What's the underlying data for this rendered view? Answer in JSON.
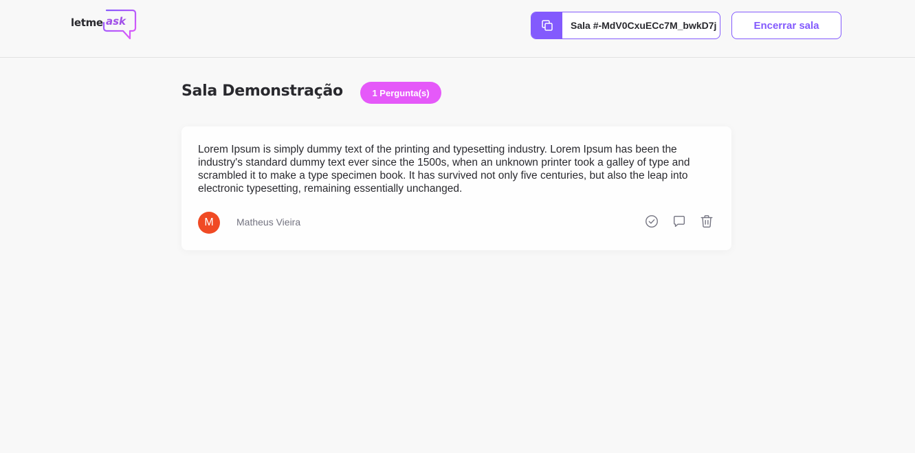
{
  "header": {
    "logo": {
      "part1": "letme",
      "part2": "ask"
    },
    "room_code": {
      "label": "Sala #-MdV0CxuECc7M_bwkD7j",
      "icon": "copy-icon"
    },
    "close_room_label": "Encerrar sala"
  },
  "room": {
    "title": "Sala Demonstração",
    "question_count_label": "1 Pergunta(s)"
  },
  "questions": [
    {
      "content": "Lorem Ipsum is simply dummy text of the printing and typesetting industry. Lorem Ipsum has been the industry's standard dummy text ever since the 1500s, when an unknown printer took a galley of type and scrambled it to make a type specimen book. It has survived not only five centuries, but also the leap into electronic typesetting, remaining essentially unchanged.",
      "author": {
        "initial": "M",
        "name": "Matheus Vieira"
      },
      "actions": [
        "check-circle-icon",
        "answer-icon",
        "trash-icon"
      ]
    }
  ],
  "colors": {
    "accent": "#835afd",
    "badge": "#e559f9",
    "avatar": "#f04a24",
    "background": "#f8f8f8"
  }
}
